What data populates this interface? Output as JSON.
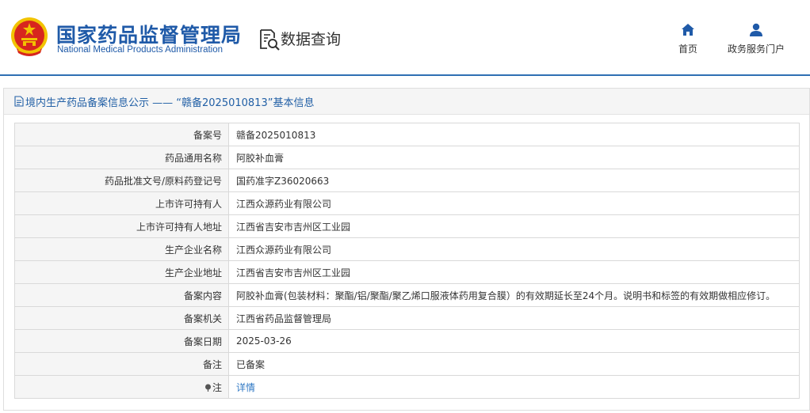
{
  "header": {
    "org_name_cn": "国家药品监督管理局",
    "org_name_en": "National Medical Products Administration",
    "section_title": "数据查询",
    "nav": [
      {
        "label": "首页",
        "icon": "home-icon"
      },
      {
        "label": "政务服务门户",
        "icon": "user-icon"
      }
    ]
  },
  "panel": {
    "title": "境内生产药品备案信息公示 —— “赣备2025010813”基本信息"
  },
  "records": [
    {
      "label": "备案号",
      "value": "赣备2025010813"
    },
    {
      "label": "药品通用名称",
      "value": "阿胶补血膏"
    },
    {
      "label": "药品批准文号/原料药登记号",
      "value": "国药准字Z36020663"
    },
    {
      "label": "上市许可持有人",
      "value": "江西众源药业有限公司"
    },
    {
      "label": "上市许可持有人地址",
      "value": "江西省吉安市吉州区工业园"
    },
    {
      "label": "生产企业名称",
      "value": "江西众源药业有限公司"
    },
    {
      "label": "生产企业地址",
      "value": "江西省吉安市吉州区工业园"
    },
    {
      "label": "备案内容",
      "value": "阿胶补血膏(包装材料：聚酯/铝/聚酯/聚乙烯口服液体药用复合膜）的有效期延长至24个月。说明书和标签的有效期做相应修订。"
    },
    {
      "label": "备案机关",
      "value": "江西省药品监督管理局"
    },
    {
      "label": "备案日期",
      "value": "2025-03-26"
    },
    {
      "label": "备注",
      "value": "已备案"
    },
    {
      "label": "注",
      "value": "详情"
    }
  ],
  "colors": {
    "brand_blue": "#1f5aa8",
    "link_blue": "#2f78c4",
    "emblem_red": "#d7261e",
    "emblem_gold": "#f2c300"
  }
}
